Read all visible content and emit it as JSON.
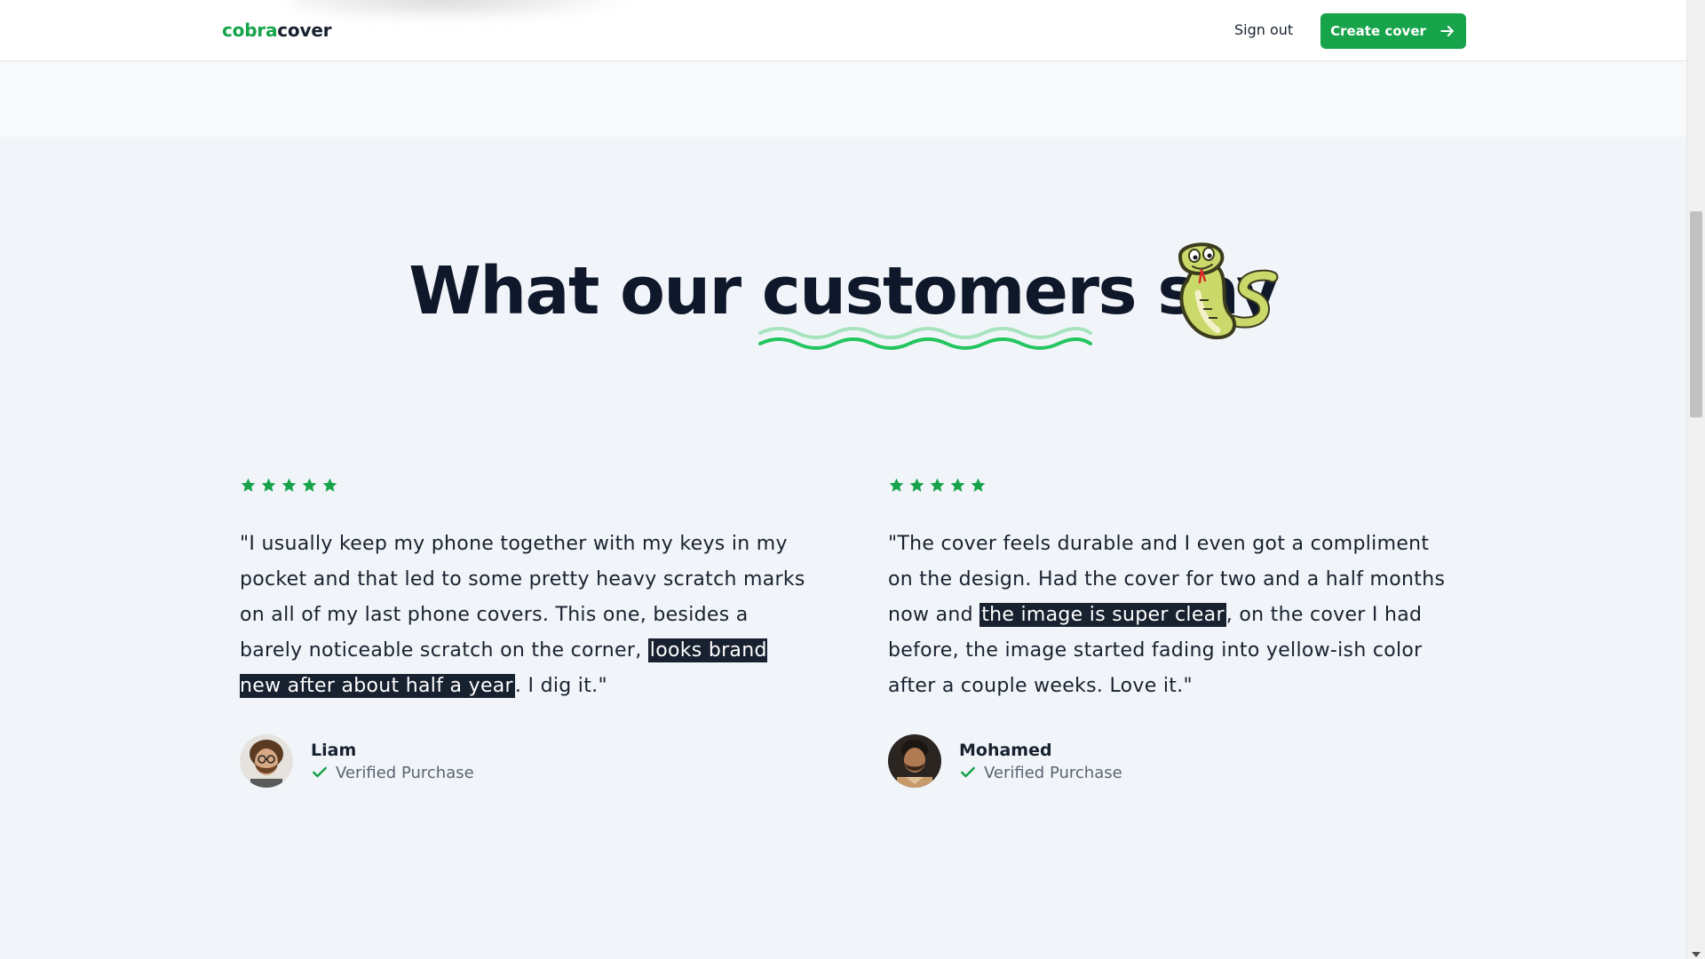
{
  "nav": {
    "brand_accent": "cobra",
    "brand_rest": "cover",
    "signout_label": "Sign out",
    "create_label": "Create cover"
  },
  "headline": {
    "part1": "What our",
    "highlight": "customers",
    "part2": "say"
  },
  "colors": {
    "brand_green": "#16a34a",
    "text_dark": "#18212f",
    "highlight_bg": "#18212f",
    "page_bg": "#f1f5f9"
  },
  "reviews": [
    {
      "rating": 5,
      "quote_before": "\"I usually keep my phone together with my keys in my pocket and that led to some pretty heavy scratch marks on all of my last phone covers. This one, besides a barely noticeable scratch on the corner, ",
      "quote_highlight": "looks brand new after about half a year",
      "quote_after": ". I dig it.\"",
      "author": "Liam",
      "verified_label": "Verified Purchase"
    },
    {
      "rating": 5,
      "quote_before": "\"The cover feels durable and I even got a compliment on the design. Had the cover for two and a half months now and ",
      "quote_highlight": "the image is super clear",
      "quote_after": ", on the cover I had before, the image started fading into yellow-ish color after a couple weeks. Love it.\"",
      "author": "Mohamed",
      "verified_label": "Verified Purchase"
    }
  ],
  "icons": {
    "star": "star-icon",
    "check": "check-icon",
    "arrow": "arrow-right-icon",
    "mascot": "snake-icon"
  }
}
